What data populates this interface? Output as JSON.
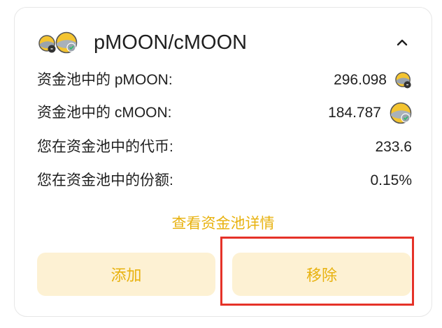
{
  "pair": {
    "title": "pMOON/cMOON",
    "icons": [
      "pmoon-token-icon",
      "cmoon-token-icon"
    ],
    "collapse_icon": "chevron-up-icon"
  },
  "rows": [
    {
      "label": "资金池中的 pMOON:",
      "value": "296.098",
      "icon": "pmoon-token-icon"
    },
    {
      "label": "资金池中的 cMOON:",
      "value": "184.787",
      "icon": "cmoon-token-icon"
    },
    {
      "label": "您在资金池中的代币:",
      "value": "233.6"
    },
    {
      "label": "您在资金池中的份额:",
      "value": "0.15%"
    }
  ],
  "details_link": "查看资金池详情",
  "buttons": {
    "add": "添加",
    "remove": "移除"
  },
  "colors": {
    "accent": "#e8b20f",
    "button_bg": "#fdf1d3",
    "highlight": "#e53228",
    "text": "#1f1f1f"
  }
}
